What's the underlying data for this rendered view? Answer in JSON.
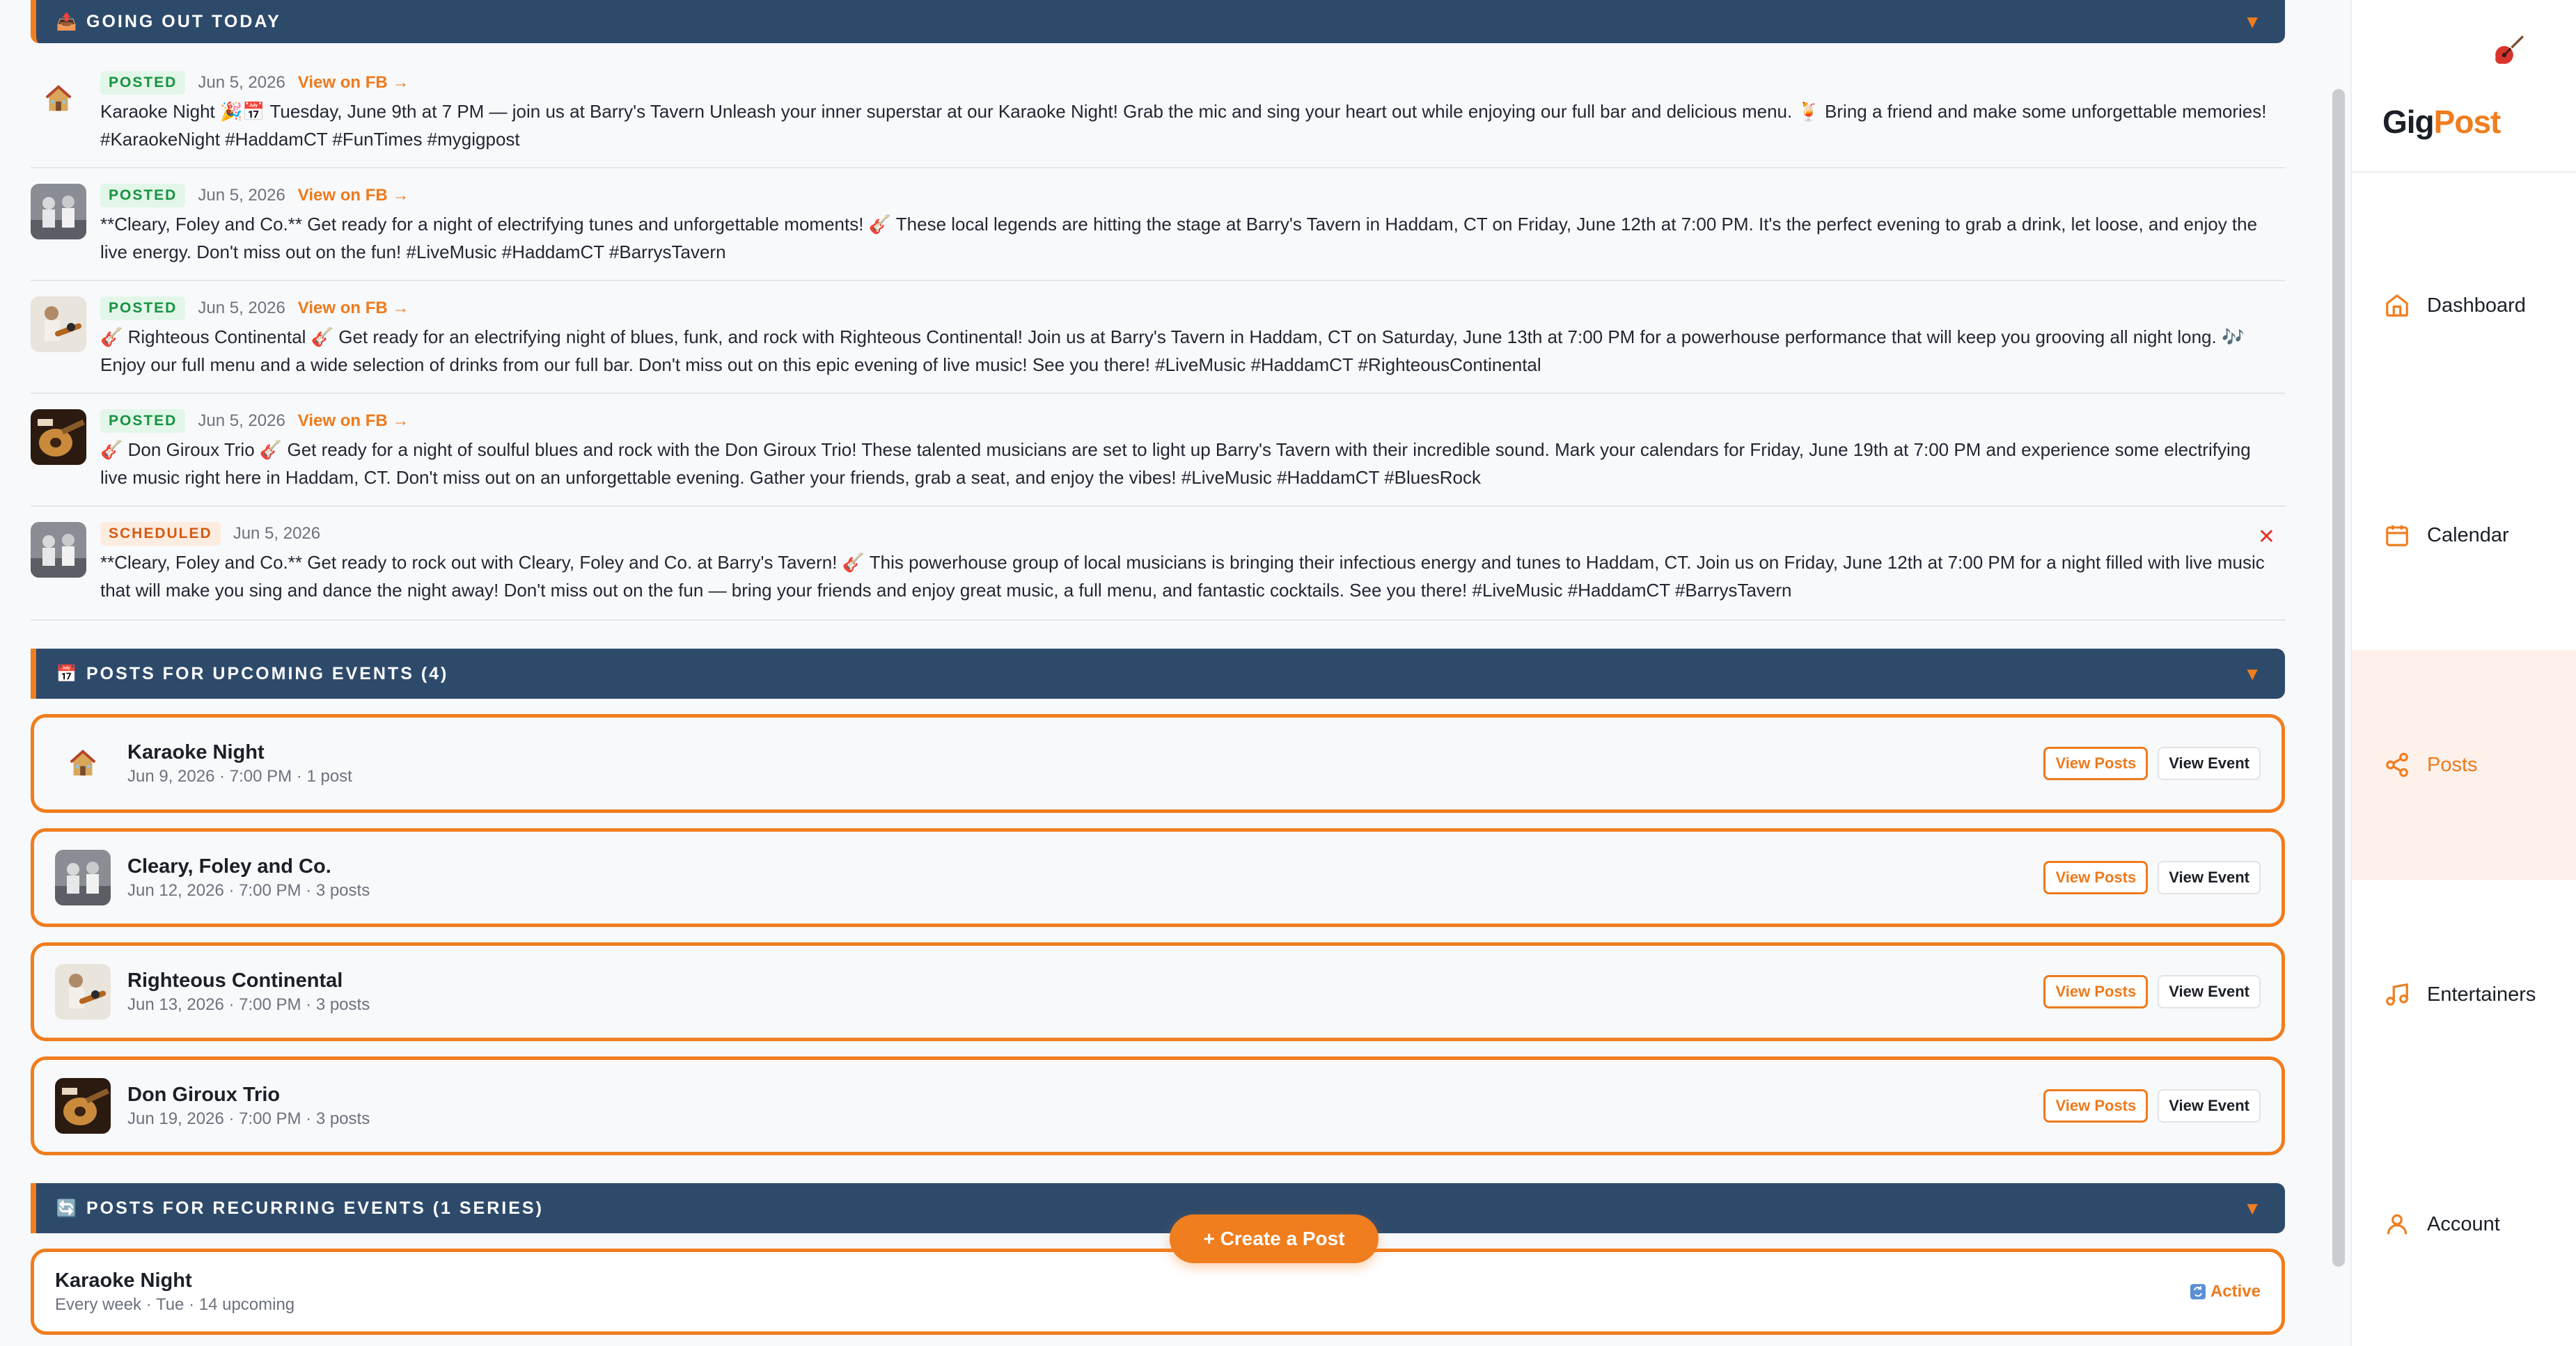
{
  "sections": {
    "today": {
      "emoji": "📤",
      "title": "GOING OUT TODAY",
      "chevron": "▼"
    },
    "upcoming": {
      "emoji": "📅",
      "title": "POSTS FOR UPCOMING EVENTS (4)",
      "chevron": "▼"
    },
    "recurring": {
      "emoji": "🔄",
      "title": "POSTS FOR RECURRING EVENTS (1 SERIES)",
      "chevron": "▼"
    }
  },
  "posts": [
    {
      "status": "POSTED",
      "date": "Jun 5, 2026",
      "link": "View on FB →",
      "text": "Karaoke Night 🎉📅 Tuesday, June 9th at 7 PM — join us at Barry's Tavern Unleash your inner superstar at our Karaoke Night! Grab the mic and sing your heart out while enjoying our full bar and delicious menu. 🍹 Bring a friend and make some unforgettable memories! #KaraokeNight #HaddamCT #FunTimes #mygigpost"
    },
    {
      "status": "POSTED",
      "date": "Jun 5, 2026",
      "link": "View on FB →",
      "text": "**Cleary, Foley and Co.** Get ready for a night of electrifying tunes and unforgettable moments! 🎸 These local legends are hitting the stage at Barry's Tavern in Haddam, CT on Friday, June 12th at 7:00 PM. It's the perfect evening to grab a drink, let loose, and enjoy the live energy. Don't miss out on the fun! #LiveMusic #HaddamCT #BarrysTavern"
    },
    {
      "status": "POSTED",
      "date": "Jun 5, 2026",
      "link": "View on FB →",
      "text": "🎸 Righteous Continental 🎸 Get ready for an electrifying night of blues, funk, and rock with Righteous Continental! Join us at Barry's Tavern in Haddam, CT on Saturday, June 13th at 7:00 PM for a powerhouse performance that will keep you grooving all night long. 🎶 Enjoy our full menu and a wide selection of drinks from our full bar. Don't miss out on this epic evening of live music! See you there! #LiveMusic #HaddamCT #RighteousContinental"
    },
    {
      "status": "POSTED",
      "date": "Jun 5, 2026",
      "link": "View on FB →",
      "text": "🎸 Don Giroux Trio 🎸 Get ready for a night of soulful blues and rock with the Don Giroux Trio! These talented musicians are set to light up Barry's Tavern with their incredible sound. Mark your calendars for Friday, June 19th at 7:00 PM and experience some electrifying live music right here in Haddam, CT. Don't miss out on an unforgettable evening. Gather your friends, grab a seat, and enjoy the vibes! #LiveMusic #HaddamCT #BluesRock"
    },
    {
      "status": "SCHEDULED",
      "date": "Jun 5, 2026",
      "link": "",
      "text": "**Cleary, Foley and Co.** Get ready to rock out with Cleary, Foley and Co. at Barry's Tavern! 🎸 This powerhouse group of local musicians is bringing their infectious energy and tunes to Haddam, CT. Join us on Friday, June 12th at 7:00 PM for a night filled with live music that will make you sing and dance the night away! Don't miss out on the fun — bring your friends and enjoy great music, a full menu, and fantastic cocktails. See you there! #LiveMusic #HaddamCT #BarrysTavern",
      "close": "✕"
    }
  ],
  "events": [
    {
      "name": "Karaoke Night",
      "sub": "Jun 9, 2026 · 7:00 PM · 1 post"
    },
    {
      "name": "Cleary, Foley and Co.",
      "sub": "Jun 12, 2026 · 7:00 PM · 3 posts"
    },
    {
      "name": "Righteous Continental",
      "sub": "Jun 13, 2026 · 7:00 PM · 3 posts"
    },
    {
      "name": "Don Giroux Trio",
      "sub": "Jun 19, 2026 · 7:00 PM · 3 posts"
    }
  ],
  "event_buttons": {
    "view_posts": "View Posts",
    "view_event": "View Event"
  },
  "series": [
    {
      "name": "Karaoke Night",
      "sub": "Every week · Tue · 14 upcoming",
      "status": "Active"
    }
  ],
  "fab": {
    "label": "+ Create a Post"
  },
  "sidebar": {
    "logo_part1": "Gig",
    "logo_part2": "Post",
    "items": [
      {
        "label": "Dashboard",
        "icon": "home-icon"
      },
      {
        "label": "Calendar",
        "icon": "calendar-icon"
      },
      {
        "label": "Posts",
        "icon": "share-icon",
        "active": true
      },
      {
        "label": "Entertainers",
        "icon": "music-note-icon"
      },
      {
        "label": "Account",
        "icon": "user-icon"
      }
    ]
  },
  "colors": {
    "accent": "#f07d1e",
    "navy": "#2e4a6b",
    "posted": "#16933f",
    "danger": "#e5322d"
  }
}
